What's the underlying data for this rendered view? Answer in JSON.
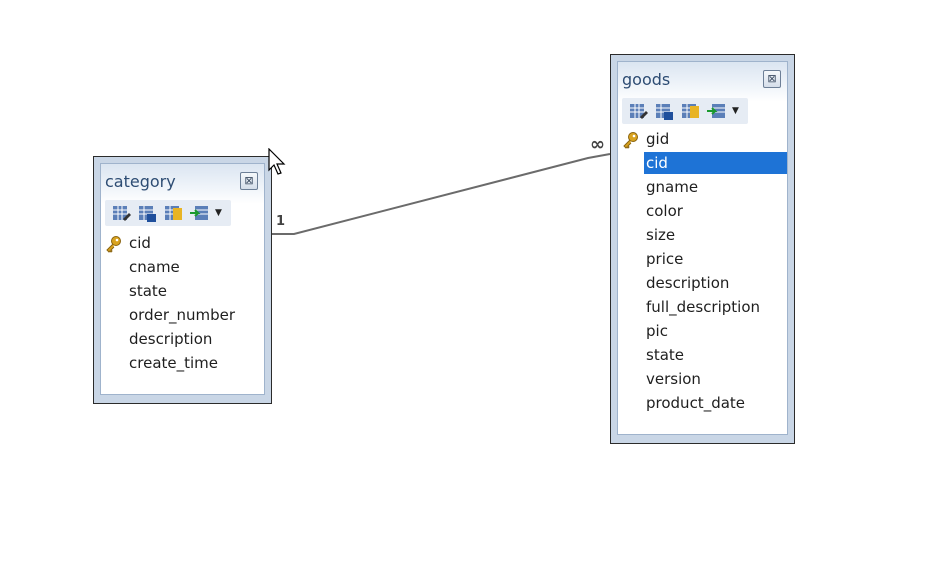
{
  "tables": [
    {
      "name": "category",
      "fields": [
        {
          "name": "cid",
          "primary_key": true
        },
        {
          "name": "cname"
        },
        {
          "name": "state"
        },
        {
          "name": "order_number"
        },
        {
          "name": "description"
        },
        {
          "name": "create_time"
        }
      ]
    },
    {
      "name": "goods",
      "fields": [
        {
          "name": "gid",
          "primary_key": true
        },
        {
          "name": "cid",
          "selected": true
        },
        {
          "name": "gname"
        },
        {
          "name": "color"
        },
        {
          "name": "size"
        },
        {
          "name": "price"
        },
        {
          "name": "description"
        },
        {
          "name": "full_description"
        },
        {
          "name": "pic"
        },
        {
          "name": "state"
        },
        {
          "name": "version"
        },
        {
          "name": "product_date"
        }
      ]
    }
  ],
  "relationship": {
    "from_label": "1",
    "to_label": "∞"
  },
  "icons": {
    "close": "close-icon",
    "key": "key-icon",
    "toolbar": [
      "table-edit-icon",
      "table-design-icon",
      "table-key-icon",
      "table-import-icon"
    ]
  },
  "colors": {
    "selection": "#1e73d6",
    "title_text": "#2d4c73",
    "frame": "#c9d6e6"
  }
}
